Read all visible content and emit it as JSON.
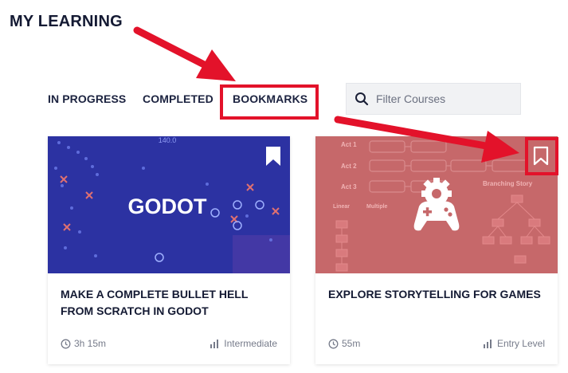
{
  "page": {
    "title": "MY LEARNING"
  },
  "tabs": [
    {
      "label": "IN PROGRESS",
      "active": false
    },
    {
      "label": "COMPLETED",
      "active": false
    },
    {
      "label": "BOOKMARKS",
      "active": true
    }
  ],
  "search": {
    "placeholder": "Filter Courses",
    "value": "",
    "icon": "search-icon"
  },
  "courses": [
    {
      "thumbnail_text": "GODOT",
      "thumbnail_overlay": "140.0",
      "title": "MAKE A COMPLETE BULLET HELL FROM SCRATCH IN GODOT",
      "duration": "3h 15m",
      "level": "Intermediate",
      "bookmarked": true
    },
    {
      "thumbnail_labels": [
        "Act 1",
        "Act 2",
        "Act 3",
        "Branching Story",
        "Linear",
        "Multiple"
      ],
      "title": "EXPLORE STORYTELLING FOR GAMES",
      "duration": "55m",
      "level": "Entry Level",
      "bookmarked": false
    }
  ],
  "annotations": {
    "highlight_color": "#e3122a",
    "arrow_count": 2
  },
  "colors": {
    "text": "#141a33",
    "godot_bg": "#2a2f9c",
    "story_bg": "#c6686a",
    "search_bg": "#f1f2f4"
  }
}
